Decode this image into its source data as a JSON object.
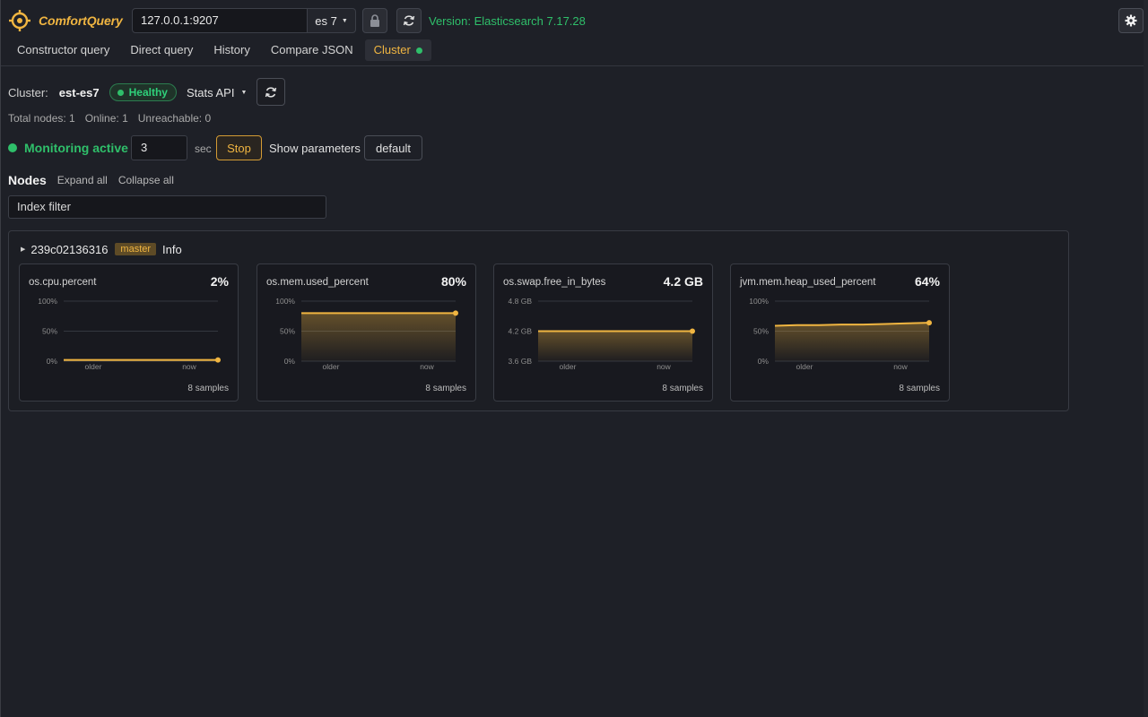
{
  "header": {
    "app_name": "ComfortQuery",
    "host": "127.0.0.1:9207",
    "es_version_select": "es 7",
    "version_text": "Version: Elasticsearch 7.17.28",
    "icons": [
      "logo-icon",
      "lock-icon",
      "refresh-icon",
      "gear-icon"
    ]
  },
  "tabs": [
    {
      "label": "Constructor query"
    },
    {
      "label": "Direct query"
    },
    {
      "label": "History"
    },
    {
      "label": "Compare JSON"
    },
    {
      "label": "Cluster",
      "active": true
    }
  ],
  "cluster": {
    "label": "Cluster:",
    "name": "est-es7",
    "health": "Healthy",
    "stats_api": "Stats API",
    "total_nodes": "Total nodes: 1",
    "online": "Online: 1",
    "unreachable": "Unreachable: 0"
  },
  "monitoring": {
    "status": "Monitoring active",
    "interval": "3",
    "unit": "sec",
    "stop_label": "Stop",
    "show_params_label": "Show parameters",
    "default_label": "default"
  },
  "nodes": {
    "title": "Nodes",
    "expand_all": "Expand all",
    "collapse_all": "Collapse all",
    "filter_placeholder": "Index filter",
    "node": {
      "id": "239c02136316",
      "role": "master",
      "info_label": "Info"
    }
  },
  "colors": {
    "accent": "#f0b541",
    "healthy": "#2fbf6a",
    "background": "#1e2027"
  },
  "chart_data": [
    {
      "type": "area",
      "title": "os.cpu.percent",
      "current": "2%",
      "y_ticks": [
        "100%",
        "50%",
        "0%"
      ],
      "x_ticks": [
        "older",
        "now"
      ],
      "ylim": [
        0,
        100
      ],
      "values": [
        2,
        2,
        2,
        2,
        2,
        2,
        2,
        2
      ],
      "samples": "8 samples"
    },
    {
      "type": "area",
      "title": "os.mem.used_percent",
      "current": "80%",
      "y_ticks": [
        "100%",
        "50%",
        "0%"
      ],
      "x_ticks": [
        "older",
        "now"
      ],
      "ylim": [
        0,
        100
      ],
      "values": [
        80,
        80,
        80,
        80,
        80,
        80,
        80,
        80
      ],
      "samples": "8 samples"
    },
    {
      "type": "area",
      "title": "os.swap.free_in_bytes",
      "current": "4.2 GB",
      "y_ticks": [
        "4.8 GB",
        "4.2 GB",
        "3.6 GB"
      ],
      "x_ticks": [
        "older",
        "now"
      ],
      "ylim": [
        3.6,
        4.8
      ],
      "values": [
        4.2,
        4.2,
        4.2,
        4.2,
        4.2,
        4.2,
        4.2,
        4.2
      ],
      "samples": "8 samples"
    },
    {
      "type": "area",
      "title": "jvm.mem.heap_used_percent",
      "current": "64%",
      "y_ticks": [
        "100%",
        "50%",
        "0%"
      ],
      "x_ticks": [
        "older",
        "now"
      ],
      "ylim": [
        0,
        100
      ],
      "values": [
        59,
        60,
        60,
        61,
        61,
        62,
        63,
        64
      ],
      "samples": "8 samples"
    }
  ]
}
